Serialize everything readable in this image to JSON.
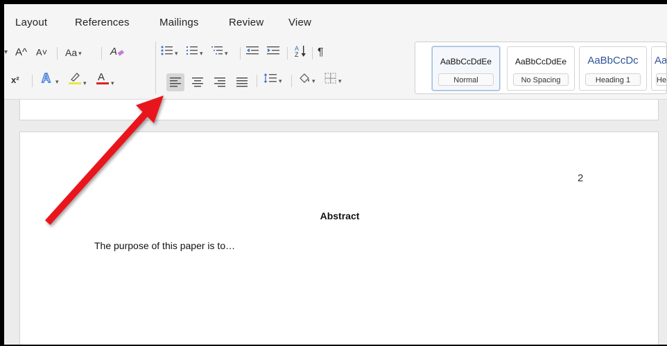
{
  "menu": {
    "tabs": [
      "Layout",
      "References",
      "Mailings",
      "Review",
      "View"
    ]
  },
  "ribbon": {
    "font_grow": "A^",
    "font_shrink": "A˅",
    "change_case": "Aa",
    "superscript": "x²",
    "text_effects": "A",
    "font_color": "A",
    "sort": "A↓Z",
    "pilcrow": "¶",
    "highlight_color": "#e8e84a",
    "font_color_bar": "#e02020",
    "text_effects_color": "#3b78d8"
  },
  "styles": {
    "items": [
      {
        "sample": "AaBbCcDdEe",
        "name": "Normal"
      },
      {
        "sample": "AaBbCcDdEe",
        "name": "No Spacing"
      },
      {
        "sample": "AaBbCcDc",
        "name": "Heading 1"
      },
      {
        "sample": "AaBb",
        "name": "He"
      }
    ]
  },
  "document": {
    "page_number": "2",
    "abstract_title": "Abstract",
    "body_text": "The purpose of this paper is to…"
  },
  "annotation": {
    "arrow_color": "#e8161a"
  }
}
